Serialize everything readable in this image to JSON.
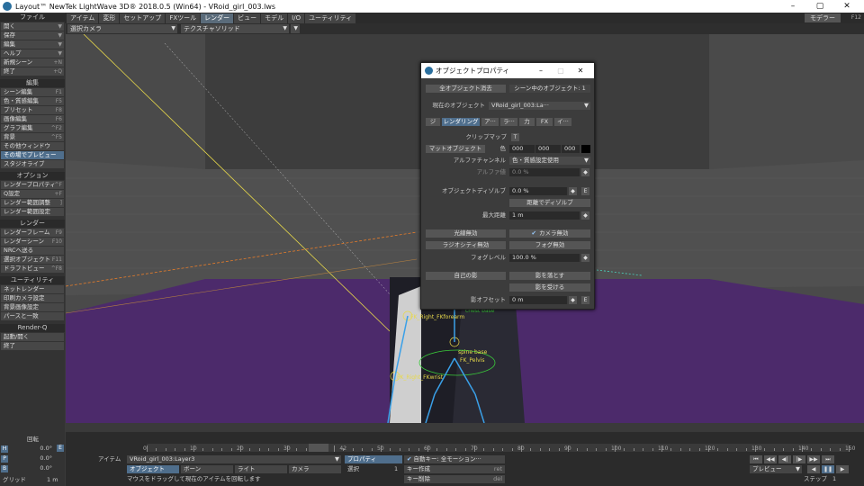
{
  "title": "Layout™ NewTek LightWave 3D® 2018.0.5 (Win64) - VRoid_girl_003.lws",
  "menu_tabs": [
    "アイテム",
    "変形",
    "セットアップ",
    "FXツール",
    "レンダー",
    "ビュー",
    "モデル",
    "I/O",
    "ユーティリティ"
  ],
  "modeler": "モデラー",
  "modeler_key": "F12",
  "viewport": {
    "camera": "選択カメラ",
    "shading": "テクスチャソリッド"
  },
  "sidebar": {
    "file_head": "ファイル",
    "file_items": [
      {
        "label": "開く"
      },
      {
        "label": "保存"
      },
      {
        "label": "編集"
      },
      {
        "label": "ヘルプ"
      },
      {
        "label": "新規シーン",
        "sc": "+N"
      },
      {
        "label": "終了",
        "sc": "+Q"
      }
    ],
    "edit_head": "編集",
    "edit_items": [
      {
        "label": "シーン編集",
        "sc": "F1"
      },
      {
        "label": "色・質感編集",
        "sc": "F5"
      },
      {
        "label": "プリセット",
        "sc": "F8"
      },
      {
        "label": "画像編集",
        "sc": "F6"
      },
      {
        "label": "グラフ編集",
        "sc": "^F2"
      },
      {
        "label": "背景",
        "sc": "^F5"
      },
      {
        "label": "その他ウィンドウ",
        "sc": ""
      },
      {
        "label": "その場でプレビュー",
        "sc": ""
      },
      {
        "label": "スタジオライブ",
        "sc": ""
      }
    ],
    "opt_head": "オプション",
    "opt_items": [
      {
        "label": "レンダープロパティ",
        "sc": "^F"
      },
      {
        "label": "Q設定",
        "sc": "+F"
      },
      {
        "label": "レンダー範囲調整",
        "sc": "]"
      },
      {
        "label": "レンダー範囲設定",
        "sc": ""
      }
    ],
    "render_head": "レンダー",
    "render_items": [
      {
        "label": "レンダーフレーム",
        "sc": "F9"
      },
      {
        "label": "レンダーシーン",
        "sc": "F10"
      },
      {
        "label": "NRCへ送る",
        "sc": ""
      },
      {
        "label": "選択オブジェクト",
        "sc": "F11"
      },
      {
        "label": "ドラフトビュー",
        "sc": "^F8"
      }
    ],
    "util_head": "ユーティリティ",
    "util_items": [
      {
        "label": "ネットレンダー"
      },
      {
        "label": "印刷カメラ設定"
      },
      {
        "label": "背景画像設定"
      },
      {
        "label": "パースと一致"
      }
    ],
    "rq_head": "Render-Q",
    "rq_items": [
      {
        "label": "起動/開く"
      },
      {
        "label": "終了"
      }
    ]
  },
  "dialog": {
    "title": "オブジェクトプロパティ",
    "clear_all": "全オブジェクト消去",
    "objects_in_scene": "シーン中のオブジェクト: 1",
    "current_label": "現在のオブジェクト",
    "current_value": "VRoid_girl_003:La···",
    "tabs": [
      "ジ",
      "レンダリング",
      "ア···",
      "ラ···",
      "力",
      "FX",
      "イ···"
    ],
    "clip_map": "クリップマップ",
    "clip_t": "T",
    "matte": "マットオブジェクト",
    "color_label": "色",
    "color_vals": [
      "000",
      "000",
      "000"
    ],
    "alpha_label": "アルファチャンネル",
    "alpha_value": "色・質感設定使用",
    "alpha_val_label": "アルファ値",
    "alpha_val": "0.0 %",
    "dissolve_label": "オブジェクトディゾルブ",
    "dissolve_val": "0.0 %",
    "dist_dissolve": "距離でディゾルブ",
    "max_dist_label": "最大距離",
    "max_dist": "1 m",
    "unseen_rays": "光線無効",
    "unseen_camera": "カメラ無効",
    "unseen_radiosity": "ラジオシティ無効",
    "unseen_fog": "フォグ無効",
    "fog_label": "フォグレベル",
    "fog_val": "100.0 %",
    "self_shadow": "自己の影",
    "cast_shadow": "影を落とす",
    "receive_shadow": "影を受ける",
    "shadow_offset_label": "影オフセット",
    "shadow_offset": "0 m",
    "e": "E"
  },
  "scene_labels": [
    "FK_Right_FKforearm",
    "spine base",
    "FK_Pelvis",
    "FK_Right_FKwrist",
    "chest base"
  ],
  "timeline": {
    "ticks": [
      "0",
      "10",
      "20",
      "30",
      "42",
      "50",
      "60",
      "70",
      "80",
      "90",
      "100",
      "110",
      "120",
      "130",
      "140",
      "150"
    ],
    "current": "42"
  },
  "left": {
    "rot": "回転",
    "h": "0.0°",
    "p": "0.0°",
    "b": "0.0°",
    "grid_label": "グリッド",
    "grid": "1 m"
  },
  "bottom": {
    "item_label": "アイテム",
    "item": "VRoid_girl_003:Layer3",
    "props": "プロパティ",
    "autokey": "自動キー: 全モーション···",
    "objects": "オブジェクト",
    "bones": "ボーン",
    "lights": "ライト",
    "cameras": "カメラ",
    "sel_label": "選択",
    "sel_val": "1",
    "create_key": "キー作成",
    "delete_key": "キー削除",
    "status": "マウスをドラッグして現在のアイテムを回転します",
    "preview": "プレビュー",
    "step": "ステップ",
    "step_val": "1",
    "enter": "ret",
    "del": "del",
    "end": "150"
  },
  "accent": "#4f6e8c",
  "floor_color": "#4c2a6b"
}
